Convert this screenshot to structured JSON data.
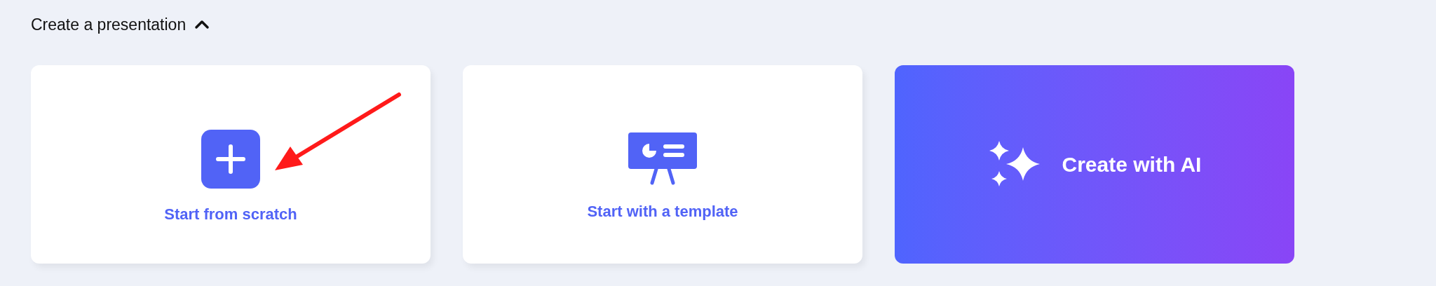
{
  "section": {
    "title": "Create a presentation",
    "expanded": true
  },
  "cards": [
    {
      "kind": "scratch",
      "label": "Start from scratch"
    },
    {
      "kind": "template",
      "label": "Start with a template"
    },
    {
      "kind": "ai",
      "label": "Create with AI"
    }
  ]
}
